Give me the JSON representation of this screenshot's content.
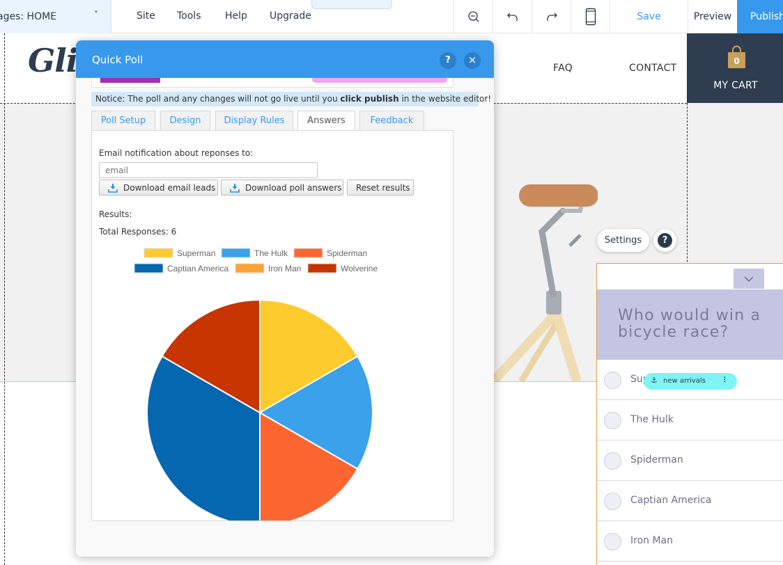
{
  "topbar": {
    "pages_label": "ages: HOME",
    "menu": [
      "Site",
      "Tools",
      "Help",
      "Upgrade"
    ],
    "save": "Save",
    "preview": "Preview",
    "publish": "Publish"
  },
  "site": {
    "logo": "Glin",
    "nav": {
      "faq": "FAQ",
      "contact": "CONTACT"
    },
    "cart": {
      "count": "0",
      "label": "MY CART"
    },
    "settings": "Settings",
    "help": "?",
    "strip_label": "new arrivals"
  },
  "widget": {
    "title": "Who would win a bicycle race?",
    "options": [
      "Superman",
      "The Hulk",
      "Spiderman",
      "Captian America",
      "Iron Man"
    ]
  },
  "dialog": {
    "title": "Quick Poll",
    "help": "?",
    "close": "×",
    "notice_pre": "Notice: The poll and any changes will not go live until you ",
    "notice_bold": "click publish",
    "notice_post": " in the website editor!",
    "tabs": [
      "Poll Setup",
      "Design",
      "Display Rules",
      "Answers",
      "Feedback"
    ],
    "active_tab": "Answers",
    "email_label": "Email notification about reponses to:",
    "email_placeholder": "email",
    "email_value": "",
    "buttons": {
      "download_leads": "Download email leads",
      "download_answers": "Download poll answers",
      "reset": "Reset results"
    },
    "results_label": "Results:",
    "total_label": "Total Responses: 6"
  },
  "colors": {
    "accent": "#3899ec",
    "cart_bg": "#2e3d4f",
    "widget_title_bg": "#c3c5e3"
  },
  "chart_data": {
    "type": "pie",
    "title": "",
    "total_responses": 6,
    "categories": [
      "Superman",
      "The Hulk",
      "Spiderman",
      "Captian America",
      "Iron Man",
      "Wolverine"
    ],
    "values": [
      1,
      1,
      1,
      2,
      0,
      1
    ],
    "colors": [
      "#fecb2f",
      "#3aa1ea",
      "#fe6631",
      "#0467b0",
      "#fea235",
      "#c73500"
    ],
    "legend_position": "top"
  }
}
